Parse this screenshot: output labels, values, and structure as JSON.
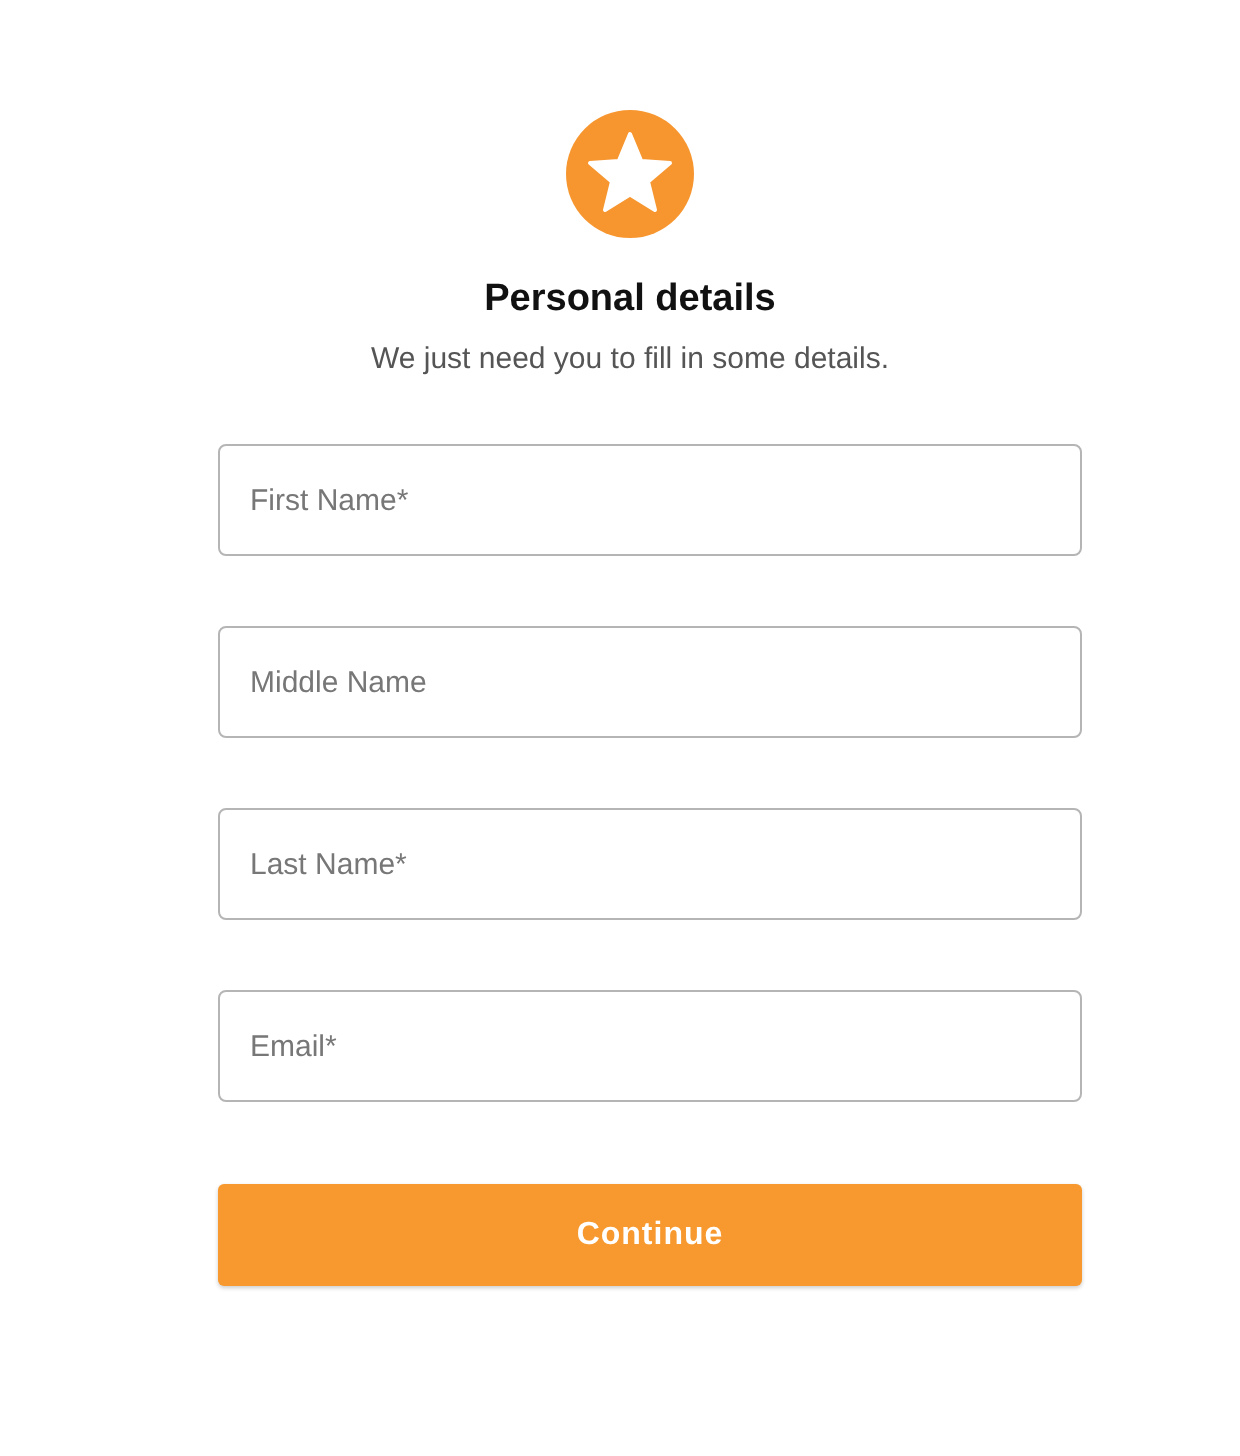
{
  "header": {
    "title": "Personal details",
    "subtitle": "We just need you to fill in some details."
  },
  "fields": [
    {
      "placeholder": "First Name*"
    },
    {
      "placeholder": "Middle Name"
    },
    {
      "placeholder": "Last Name*"
    },
    {
      "placeholder": "Email*"
    }
  ],
  "button": {
    "label": "Continue"
  }
}
